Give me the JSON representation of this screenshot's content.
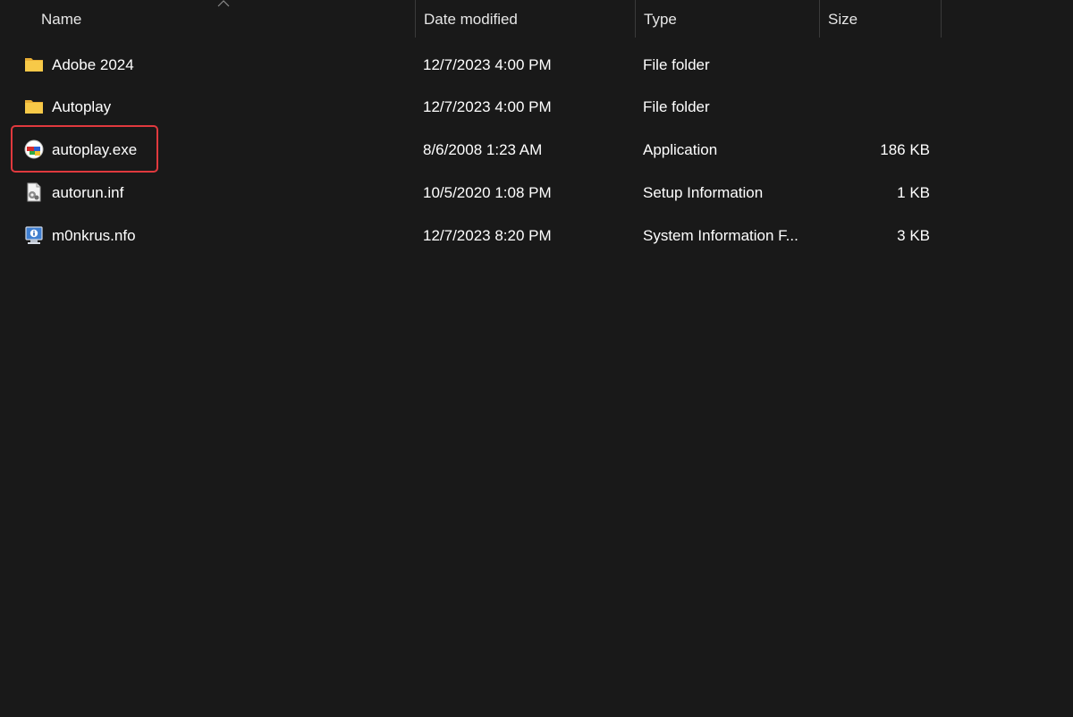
{
  "columns": {
    "name": "Name",
    "date": "Date modified",
    "type": "Type",
    "size": "Size"
  },
  "sort": {
    "column": "name",
    "direction": "ascending",
    "icon": "chevron-up-icon"
  },
  "files": [
    {
      "name": "Adobe 2024",
      "date": "12/7/2023 4:00 PM",
      "type": "File folder",
      "size": "",
      "icon": "folder-icon"
    },
    {
      "name": "Autoplay",
      "date": "12/7/2023 4:00 PM",
      "type": "File folder",
      "size": "",
      "icon": "folder-icon"
    },
    {
      "name": "autoplay.exe",
      "date": "8/6/2008 1:23 AM",
      "type": "Application",
      "size": "186 KB",
      "icon": "application-icon",
      "highlighted": true
    },
    {
      "name": "autorun.inf",
      "date": "10/5/2020 1:08 PM",
      "type": "Setup Information",
      "size": "1 KB",
      "icon": "setup-information-icon"
    },
    {
      "name": "m0nkrus.nfo",
      "date": "12/7/2023 8:20 PM",
      "type": "System Information F...",
      "size": "3 KB",
      "icon": "system-information-icon"
    }
  ],
  "colors": {
    "background": "#191919",
    "text": "#ffffff",
    "folder": "#f5c24a",
    "highlight": "#e0393e"
  }
}
